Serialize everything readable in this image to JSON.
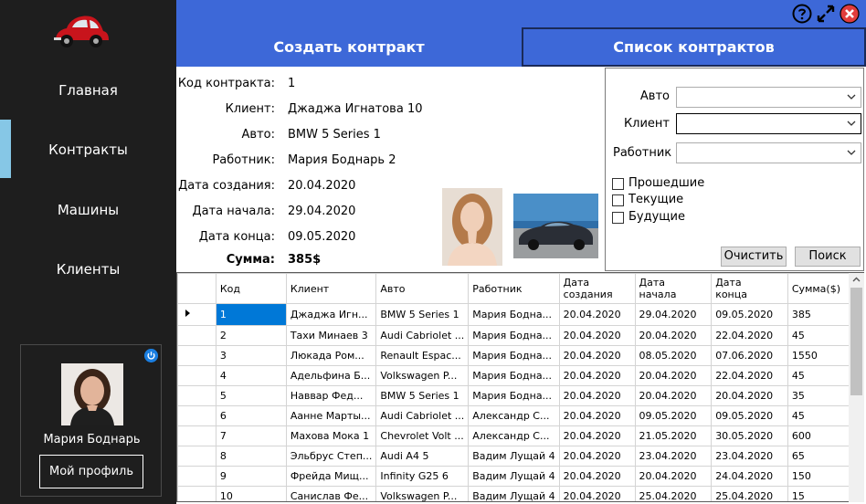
{
  "sidebar": {
    "nav": [
      "Главная",
      "Контракты",
      "Машины",
      "Клиенты"
    ],
    "active_index": 1,
    "profile": {
      "name": "Мария Боднарь",
      "button": "Мой профиль"
    }
  },
  "tabs": [
    "Создать контракт",
    "Список контрактов"
  ],
  "details": {
    "fields": [
      {
        "label": "Код контракта:",
        "value": "1"
      },
      {
        "label": "Клиент:",
        "value": "Джаджа Игнатова 10"
      },
      {
        "label": "Авто:",
        "value": "BMW 5 Series 1"
      },
      {
        "label": "Работник:",
        "value": "Мария Боднарь 2"
      },
      {
        "label": "Дата создания:",
        "value": "20.04.2020"
      },
      {
        "label": "Дата начала:",
        "value": "29.04.2020"
      },
      {
        "label": "Дата конца:",
        "value": "09.05.2020"
      },
      {
        "label": "Сумма:",
        "value": "385$"
      }
    ]
  },
  "filter": {
    "auto_label": "Авто",
    "client_label": "Клиент",
    "worker_label": "Работник",
    "checkboxes": [
      "Прошедшие",
      "Текущие",
      "Будущие"
    ],
    "clear_button": "Очистить",
    "search_button": "Поиск"
  },
  "grid": {
    "columns": [
      "Код",
      "Клиент",
      "Авто",
      "Работник",
      "Дата\nсоздания",
      "Дата\nначала",
      "Дата\nконца",
      "Сумма($)"
    ],
    "rows": [
      [
        "1",
        "Джаджа Игн...",
        "BMW 5 Series 1",
        "Мария Бодна...",
        "20.04.2020",
        "29.04.2020",
        "09.05.2020",
        "385"
      ],
      [
        "2",
        "Тахи Минаев 3",
        "Audi Cabriolet ...",
        "Мария Бодна...",
        "20.04.2020",
        "20.04.2020",
        "22.04.2020",
        "45"
      ],
      [
        "3",
        "Люкада Ром...",
        "Renault Espac...",
        "Мария Бодна...",
        "20.04.2020",
        "08.05.2020",
        "07.06.2020",
        "1550"
      ],
      [
        "4",
        "Адельфина Б...",
        "Volkswagen P...",
        "Мария Бодна...",
        "20.04.2020",
        "20.04.2020",
        "22.04.2020",
        "45"
      ],
      [
        "5",
        "Наввар Фед...",
        "BMW 5 Series 1",
        "Мария Бодна...",
        "20.04.2020",
        "20.04.2020",
        "20.04.2020",
        "35"
      ],
      [
        "6",
        "Аанне Марты...",
        "Audi Cabriolet ...",
        "Александр С...",
        "20.04.2020",
        "09.05.2020",
        "09.05.2020",
        "45"
      ],
      [
        "7",
        "Махова Мока 1",
        "Chevrolet Volt ...",
        "Александр С...",
        "20.04.2020",
        "21.05.2020",
        "30.05.2020",
        "600"
      ],
      [
        "8",
        "Эльбрус Степ...",
        "Audi A4 5",
        "Вадим Лущай 4",
        "20.04.2020",
        "23.04.2020",
        "23.04.2020",
        "65"
      ],
      [
        "9",
        "Фрейда Мищ...",
        "Infinity G25 6",
        "Вадим Лущай 4",
        "20.04.2020",
        "20.04.2020",
        "24.04.2020",
        "150"
      ],
      [
        "10",
        "Санислав Фе...",
        "Volkswagen P...",
        "Вадим Лущай 4",
        "20.04.2020",
        "25.04.2020",
        "25.04.2020",
        "15"
      ]
    ],
    "selected_row": 0
  },
  "colors": {
    "sidebar": "#1e1e1e",
    "accent": "#3d68d8",
    "active_indicator": "#86c7e6",
    "selection": "#0078d7",
    "close": "#e03c3c"
  },
  "icons": [
    "car-logo-icon",
    "help-icon",
    "expand-icon",
    "close-icon",
    "power-icon",
    "chevron-down-icon",
    "row-pointer-icon"
  ]
}
